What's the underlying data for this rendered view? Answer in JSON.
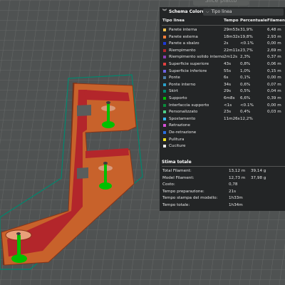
{
  "top_button": "Slice piatto",
  "panel": {
    "schema_label": "Schema Colore",
    "view_type": "Tipo linea",
    "headers": {
      "type": "Tipo linea",
      "time": "Tempo",
      "percent": "Percentuale",
      "filament": "Filament"
    },
    "rows": [
      {
        "name": "Parete interna",
        "time": "29m53s",
        "percent": "31,9%",
        "filament": "6,48 m",
        "color": "#f2c14e"
      },
      {
        "name": "Parete esterna",
        "time": "18m32s",
        "percent": "19,8%",
        "filament": "2,93 m",
        "color": "#ff7d38"
      },
      {
        "name": "Parete a sbalzo",
        "time": "2s",
        "percent": "<0.1%",
        "filament": "0,00 m",
        "color": "#1f3ad6"
      },
      {
        "name": "Riempimento",
        "time": "22m11s",
        "percent": "23,7%",
        "filament": "2,69 m",
        "color": "#b3262b"
      },
      {
        "name": "Riempimento solido interno",
        "time": "2m12s",
        "percent": "2,3%",
        "filament": "0,37 m",
        "color": "#8a3fb5"
      },
      {
        "name": "Superficie superiore",
        "time": "43s",
        "percent": "0,8%",
        "filament": "0,06 m",
        "color": "#e04040"
      },
      {
        "name": "Superficie inferiore",
        "time": "55s",
        "percent": "1,0%",
        "filament": "0,15 m",
        "color": "#6f63e6"
      },
      {
        "name": "Ponte",
        "time": "6s",
        "percent": "0,1%",
        "filament": "0,00 m",
        "color": "#4d7ea8"
      },
      {
        "name": "Ponte interno",
        "time": "34s",
        "percent": "0,6%",
        "filament": "0,07 m",
        "color": "#2aa0c8"
      },
      {
        "name": "Skirt",
        "time": "29s",
        "percent": "0,5%",
        "filament": "0,04 m",
        "color": "#00876e"
      },
      {
        "name": "Supporto",
        "time": "6m8s",
        "percent": "6,6%",
        "filament": "0,39 m",
        "color": "#00c000"
      },
      {
        "name": "Interfaccia supporto",
        "time": "<1s",
        "percent": "<0.1%",
        "filament": "0,00 m",
        "color": "#0a8a3a"
      },
      {
        "name": "Personalizzato",
        "time": "23s",
        "percent": "0,4%",
        "filament": "0,03 m",
        "color": "#4ecf8a"
      },
      {
        "name": "Spostamento",
        "time": "11m26s",
        "percent": "12,2%",
        "filament": "",
        "color": "#38b6ff"
      },
      {
        "name": "Retrazione",
        "time": "",
        "percent": "",
        "filament": "",
        "color": "#d64fd6"
      },
      {
        "name": "De-retrazione",
        "time": "",
        "percent": "",
        "filament": "",
        "color": "#2a6fe0"
      },
      {
        "name": "Pulitura",
        "time": "",
        "percent": "",
        "filament": "",
        "color": "#f0e020"
      },
      {
        "name": "Cuciture",
        "time": "",
        "percent": "",
        "filament": "",
        "color": "#e8e8e8"
      }
    ],
    "stima_title": "Stima totale",
    "stima": [
      {
        "label": "Total Filament:",
        "v1": "13,12 m",
        "v2": "39,14 g"
      },
      {
        "label": "Model Filament:",
        "v1": "12,73 m",
        "v2": "37,98 g"
      },
      {
        "label": "Costo:",
        "v1": "0,78",
        "v2": ""
      },
      {
        "label": "Tempo preparazione:",
        "v1": "21s",
        "v2": ""
      },
      {
        "label": "Tempo stampa del modello:",
        "v1": "1h33m",
        "v2": ""
      },
      {
        "label": "Tempo totale:",
        "v1": "1h34m",
        "v2": ""
      }
    ]
  }
}
